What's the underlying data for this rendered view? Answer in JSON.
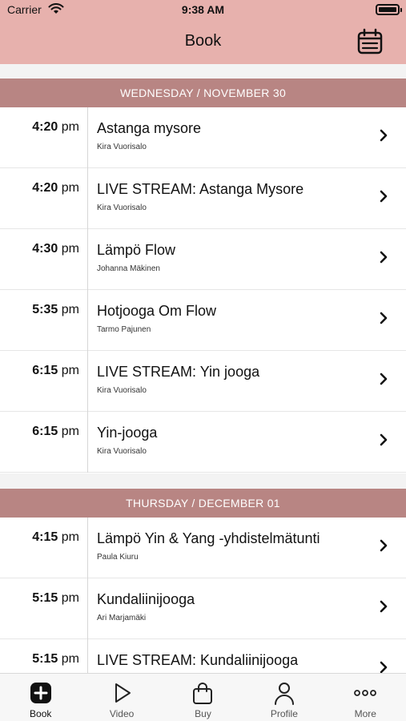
{
  "status_bar": {
    "carrier": "Carrier",
    "time": "9:38 AM"
  },
  "nav": {
    "title": "Book"
  },
  "days": [
    {
      "header": "WEDNESDAY / NOVEMBER 30",
      "classes": [
        {
          "time": "4:20",
          "ampm": "pm",
          "title": "Astanga mysore",
          "teacher": "Kira Vuorisalo"
        },
        {
          "time": "4:20",
          "ampm": "pm",
          "title": "LIVE STREAM: Astanga Mysore",
          "teacher": "Kira Vuorisalo"
        },
        {
          "time": "4:30",
          "ampm": "pm",
          "title": "Lämpö Flow",
          "teacher": "Johanna Mäkinen"
        },
        {
          "time": "5:35",
          "ampm": "pm",
          "title": "Hotjooga Om Flow",
          "teacher": "Tarmo Pajunen"
        },
        {
          "time": "6:15",
          "ampm": "pm",
          "title": "LIVE STREAM: Yin jooga",
          "teacher": "Kira Vuorisalo"
        },
        {
          "time": "6:15",
          "ampm": "pm",
          "title": "Yin-jooga",
          "teacher": "Kira Vuorisalo"
        }
      ]
    },
    {
      "header": "THURSDAY / DECEMBER 01",
      "classes": [
        {
          "time": "4:15",
          "ampm": "pm",
          "title": "Lämpö Yin & Yang -yhdistelmätunti",
          "teacher": "Paula Kiuru"
        },
        {
          "time": "5:15",
          "ampm": "pm",
          "title": "Kundaliinijooga",
          "teacher": "Ari Marjamäki"
        },
        {
          "time": "5:15",
          "ampm": "pm",
          "title": "LIVE STREAM: Kundaliinijooga",
          "teacher": ""
        }
      ]
    }
  ],
  "tabs": [
    {
      "label": "Book",
      "icon": "plus-square-icon",
      "active": true
    },
    {
      "label": "Video",
      "icon": "play-icon",
      "active": false
    },
    {
      "label": "Buy",
      "icon": "shopping-bag-icon",
      "active": false
    },
    {
      "label": "Profile",
      "icon": "person-icon",
      "active": false
    },
    {
      "label": "More",
      "icon": "more-dots-icon",
      "active": false
    }
  ],
  "colors": {
    "header_pink": "#e7b1ad",
    "day_header": "#b88583",
    "divider": "#d6d6d6"
  }
}
